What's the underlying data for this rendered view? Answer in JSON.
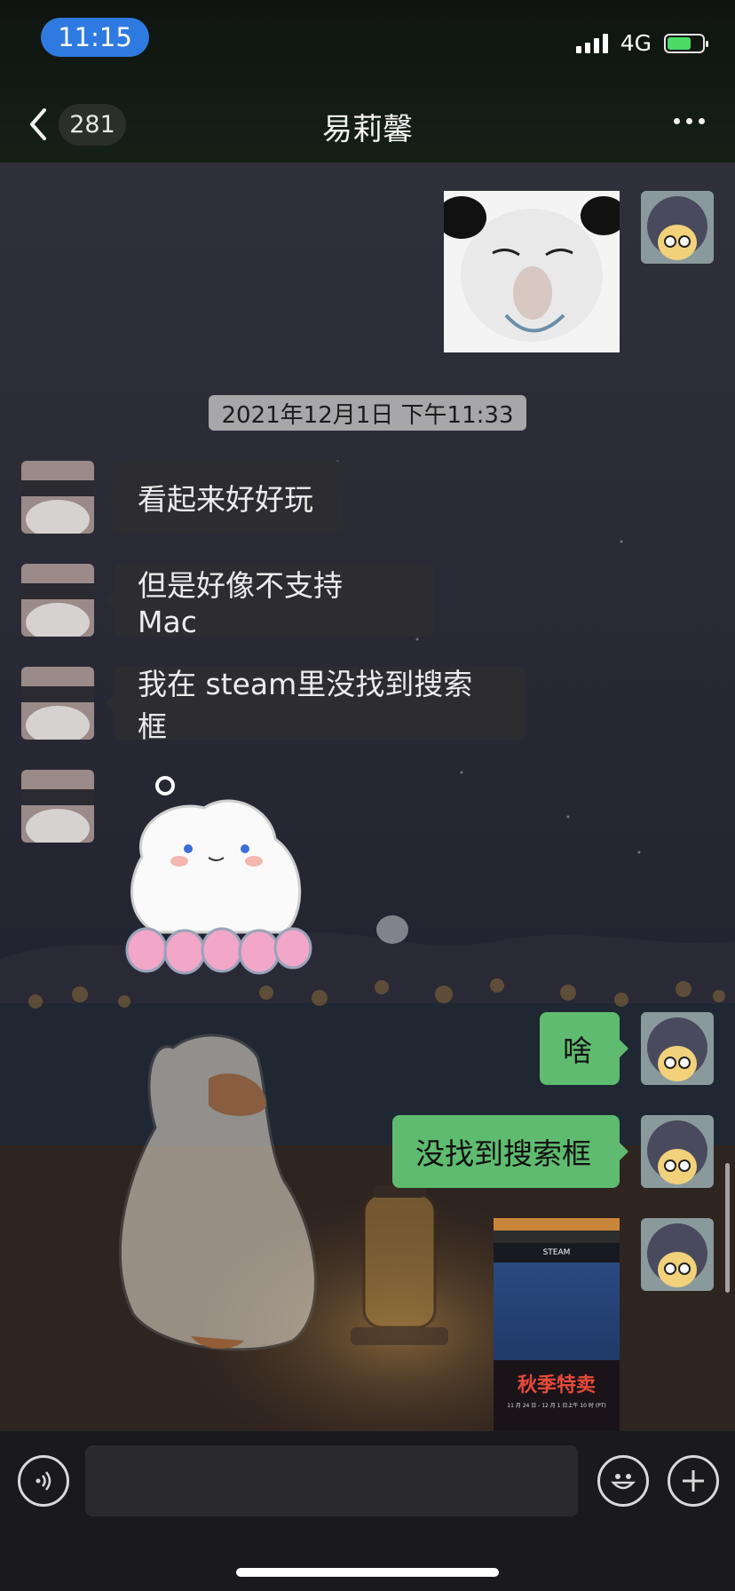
{
  "status_bar": {
    "time": "11:15",
    "network": "4G"
  },
  "nav": {
    "unread_count": "281",
    "title": "易莉馨"
  },
  "chat": {
    "timestamp": "2021年12月1日 下午11:33",
    "messages": [
      {
        "side": "left",
        "text": "看起来好好玩"
      },
      {
        "side": "left",
        "text": "但是好像不支持 Mac"
      },
      {
        "side": "left",
        "text": "我在 steam里没找到搜索框"
      },
      {
        "side": "right",
        "text": "啥"
      },
      {
        "side": "right",
        "text": "没找到搜索框"
      }
    ],
    "screenshot_thumb": {
      "logo": "STEAM",
      "promo": "秋季特卖",
      "promo_date": "11 月 24 日 - 12 月 1 日上午 10 时 (PT)"
    }
  },
  "colors": {
    "sent_bubble": "#5fbb6f",
    "received_bubble": "#2d2d31",
    "timestamp_bg": "#a7a7a9",
    "time_pill": "#2f7ae0"
  }
}
